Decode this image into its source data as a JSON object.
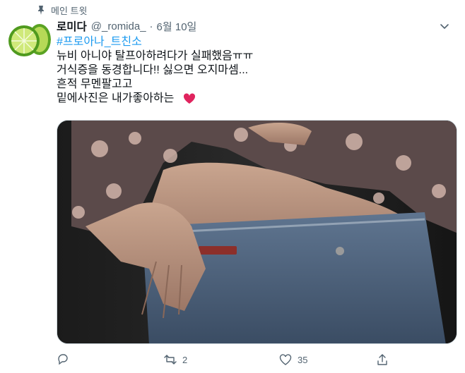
{
  "pinned_label": "메인 트윗",
  "tweet": {
    "display_name": "로미다",
    "handle": "@_romida_",
    "separator": "·",
    "date": "6월 10일",
    "hashtag": "#프로아나_트친소",
    "lines": [
      "뉴비 아니야 탈프아하려다가 실패했음ㅠㅠ",
      "거식증을 동경합니다!! 싫으면 오지마셈...",
      "흔적 무멘팔고고",
      "밑에사진은 내가좋아하는"
    ]
  },
  "actions": {
    "retweet_count": "2",
    "like_count": "35"
  },
  "colors": {
    "accent": "#1d9bf0",
    "secondary_text": "#536471",
    "heart": "#e0245e"
  }
}
